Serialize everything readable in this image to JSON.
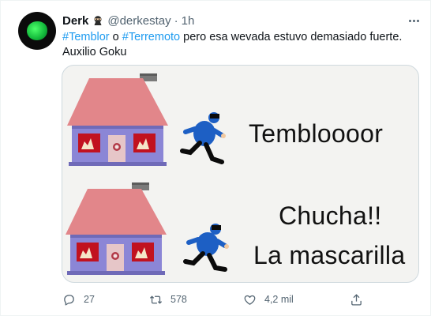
{
  "tweet": {
    "author_name": "Derk",
    "author_emoji_icon": "ninja-emoji-icon",
    "handle": "@derkestay",
    "separator": "·",
    "time": "1h",
    "text_parts": {
      "hashtag1": "#Temblor",
      "word1": " o ",
      "hashtag2": "#Terremoto",
      "rest": " pero esa wevada estuvo demasiado fuerte. Auxilio Goku"
    },
    "media": {
      "panel1_text": "Tembloooor",
      "panel2_line1": "Chucha!!",
      "panel2_line2": "La mascarilla"
    },
    "actions": {
      "reply_count": "27",
      "retweet_count": "578",
      "like_count": "4,2 mil"
    }
  },
  "colors": {
    "link": "#1d9bf0",
    "muted": "#536471",
    "text": "#0f1419",
    "border": "#cfd9de"
  }
}
